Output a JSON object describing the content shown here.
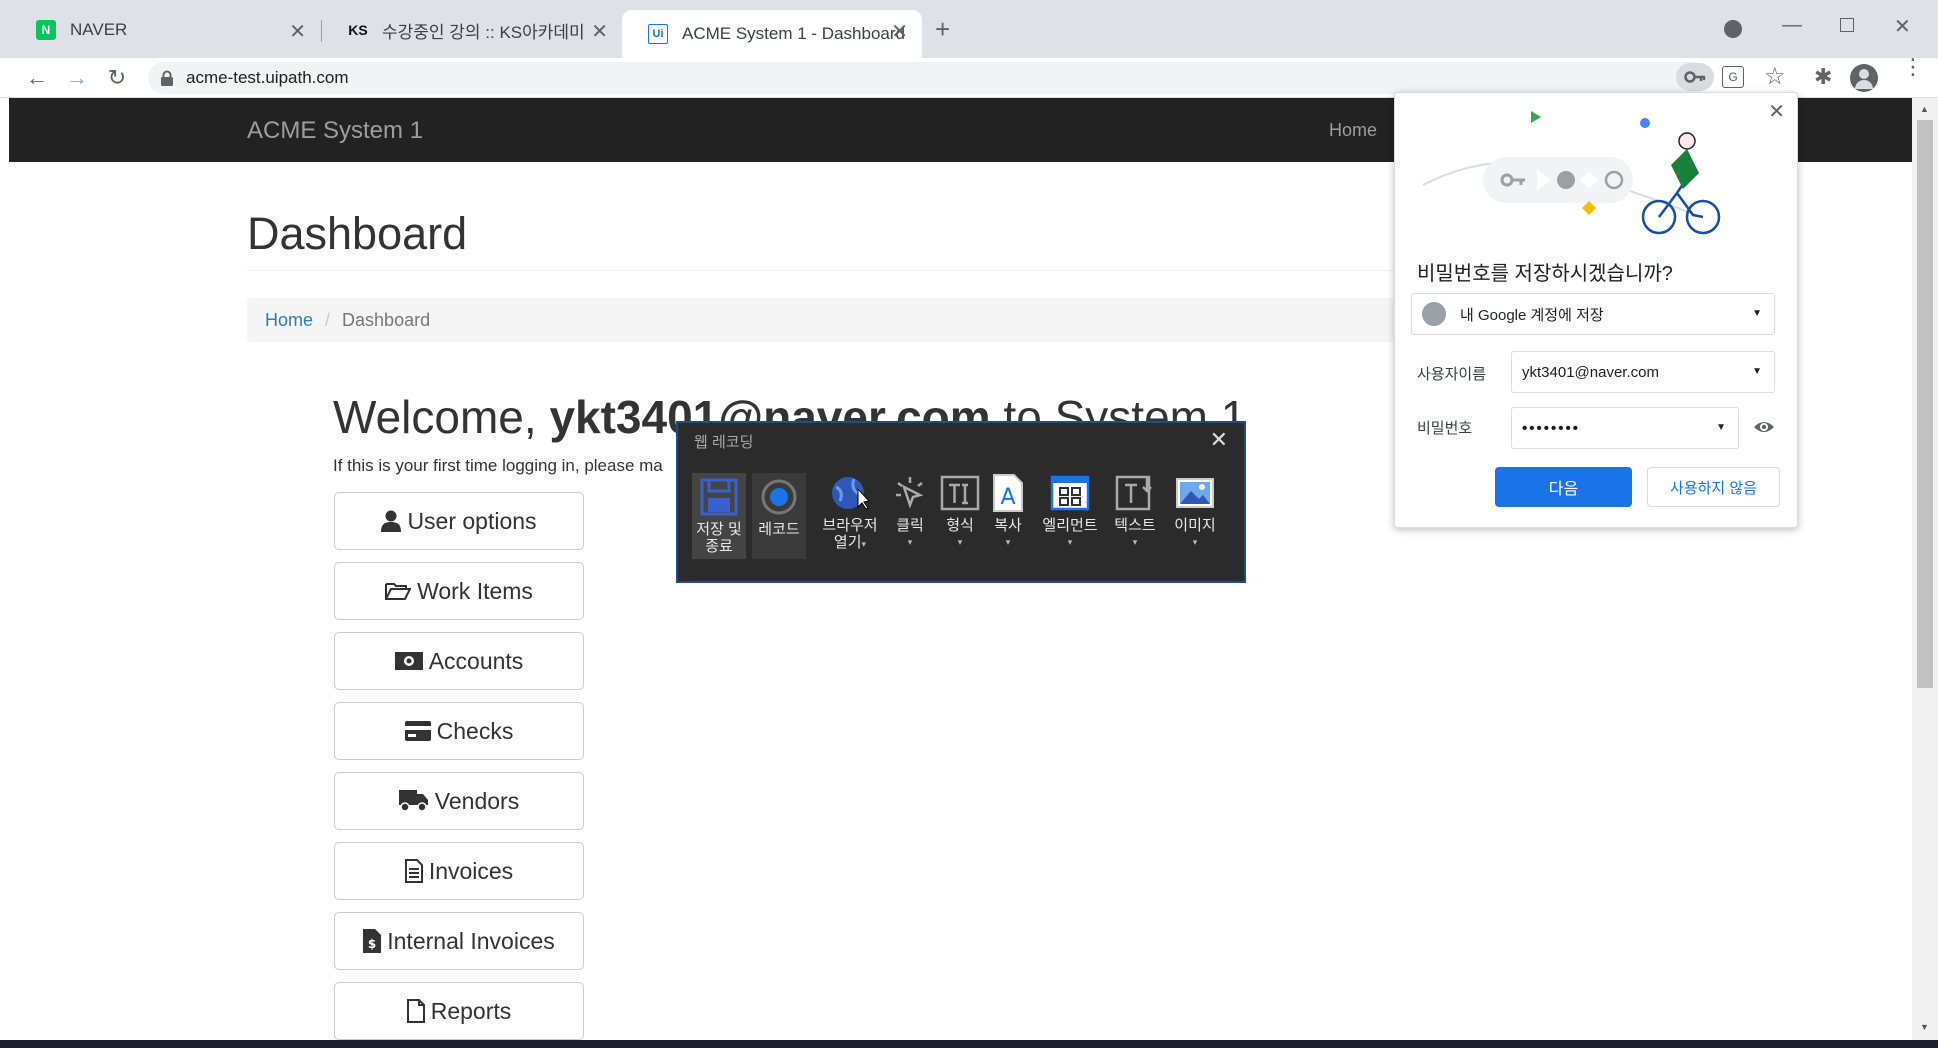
{
  "browser": {
    "tabs": [
      {
        "title": "NAVER",
        "favicon": "N"
      },
      {
        "title": "수강중인 강의 :: KS아카데미",
        "favicon": "KS"
      },
      {
        "title": "ACME System 1 - Dashboard",
        "favicon": "Ui"
      }
    ],
    "url": "acme-test.uipath.com"
  },
  "page": {
    "brand": "ACME System 1",
    "nav_home": "Home",
    "title": "Dashboard",
    "breadcrumb": {
      "home": "Home",
      "current": "Dashboard"
    },
    "welcome_prefix": "Welcome, ",
    "welcome_user": "ykt3401@naver.com",
    "welcome_suffix": " to System 1",
    "hint": "If this is your first time logging in, please ma",
    "menu": [
      {
        "label": "User options",
        "icon": "user-icon"
      },
      {
        "label": "Work Items",
        "icon": "folder-open-icon"
      },
      {
        "label": "Accounts",
        "icon": "money-icon"
      },
      {
        "label": "Checks",
        "icon": "credit-card-icon"
      },
      {
        "label": "Vendors",
        "icon": "truck-icon"
      },
      {
        "label": "Invoices",
        "icon": "file-text-icon"
      },
      {
        "label": "Internal Invoices",
        "icon": "file-invoice-dollar-icon"
      },
      {
        "label": "Reports",
        "icon": "file-icon"
      }
    ]
  },
  "recorder": {
    "title": "웹 레코딩",
    "tools": [
      {
        "line1": "저장 및",
        "line2": "종료"
      },
      {
        "line1": "레코드",
        "line2": ""
      },
      {
        "line1": "브라우저",
        "line2": "열기"
      },
      {
        "line1": "클릭",
        "line2": ""
      },
      {
        "line1": "형식",
        "line2": ""
      },
      {
        "line1": "복사",
        "line2": ""
      },
      {
        "line1": "엘리먼트",
        "line2": ""
      },
      {
        "line1": "텍스트",
        "line2": ""
      },
      {
        "line1": "이미지",
        "line2": ""
      }
    ]
  },
  "password_popup": {
    "question": "비밀번호를 저장하시겠습니까?",
    "account": "내 Google 계정에 저장",
    "username_label": "사용자이름",
    "username_value": "ykt3401@naver.com",
    "password_label": "비밀번호",
    "password_value": "••••••••",
    "save_label": "다음",
    "never_label": "사용하지 않음"
  },
  "colors": {
    "accent": "#1a73e8",
    "navbar": "#222222",
    "link": "#337ab7"
  }
}
